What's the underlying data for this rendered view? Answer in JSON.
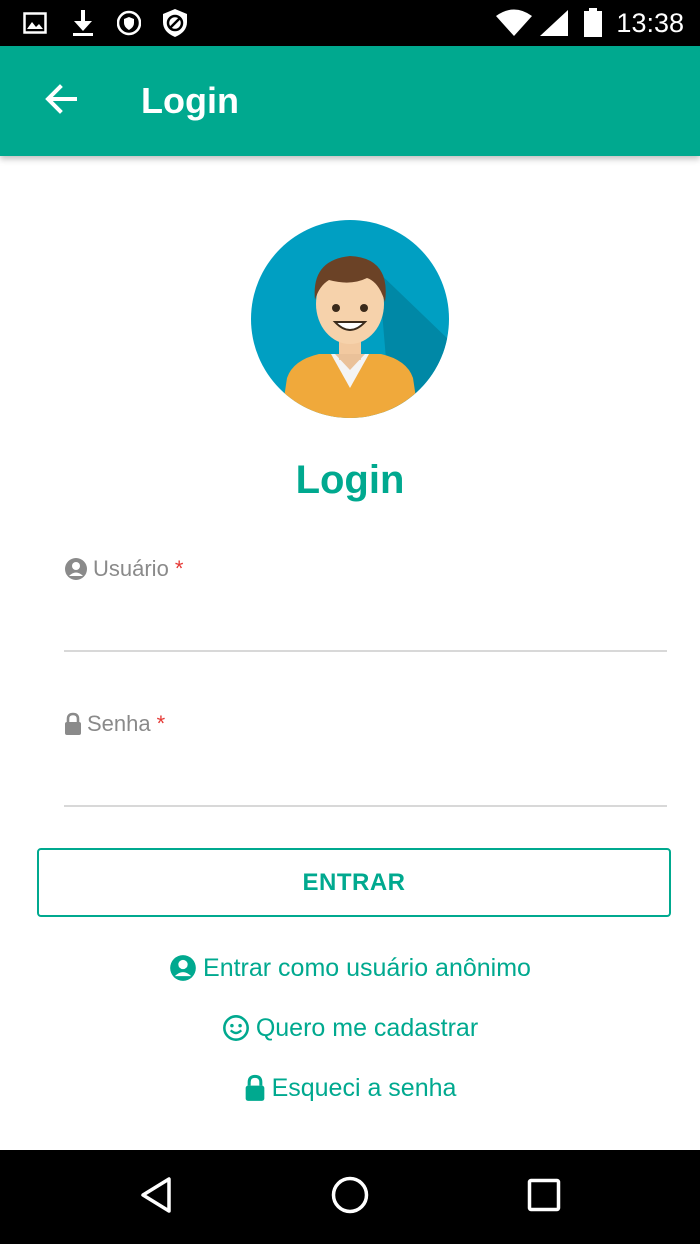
{
  "status_bar": {
    "time": "13:38",
    "icons": [
      "image-icon",
      "download-icon",
      "shield-icon",
      "block-icon",
      "wifi-icon",
      "signal-icon",
      "battery-icon"
    ]
  },
  "app_bar": {
    "title": "Login",
    "back_icon": "arrow-back-icon"
  },
  "main": {
    "heading": "Login",
    "avatar": "user-avatar",
    "fields": [
      {
        "label": "Usuário",
        "required_mark": "*",
        "icon": "account-circle-icon",
        "value": ""
      },
      {
        "label": "Senha",
        "required_mark": "*",
        "icon": "lock-icon",
        "value": ""
      }
    ],
    "submit_label": "ENTRAR",
    "links": [
      {
        "label": "Entrar como usuário anônimo",
        "icon": "account-circle-icon"
      },
      {
        "label": "Quero me cadastrar",
        "icon": "smile-icon"
      },
      {
        "label": "Esqueci a senha",
        "icon": "lock-icon"
      }
    ]
  },
  "nav_bar": {
    "icons": [
      "back-triangle-icon",
      "home-circle-icon",
      "recents-square-icon"
    ]
  },
  "colors": {
    "primary": "#00a98f",
    "required": "#e53935",
    "avatar_bg": "#00a0c4",
    "avatar_shirt": "#f0a93b"
  }
}
